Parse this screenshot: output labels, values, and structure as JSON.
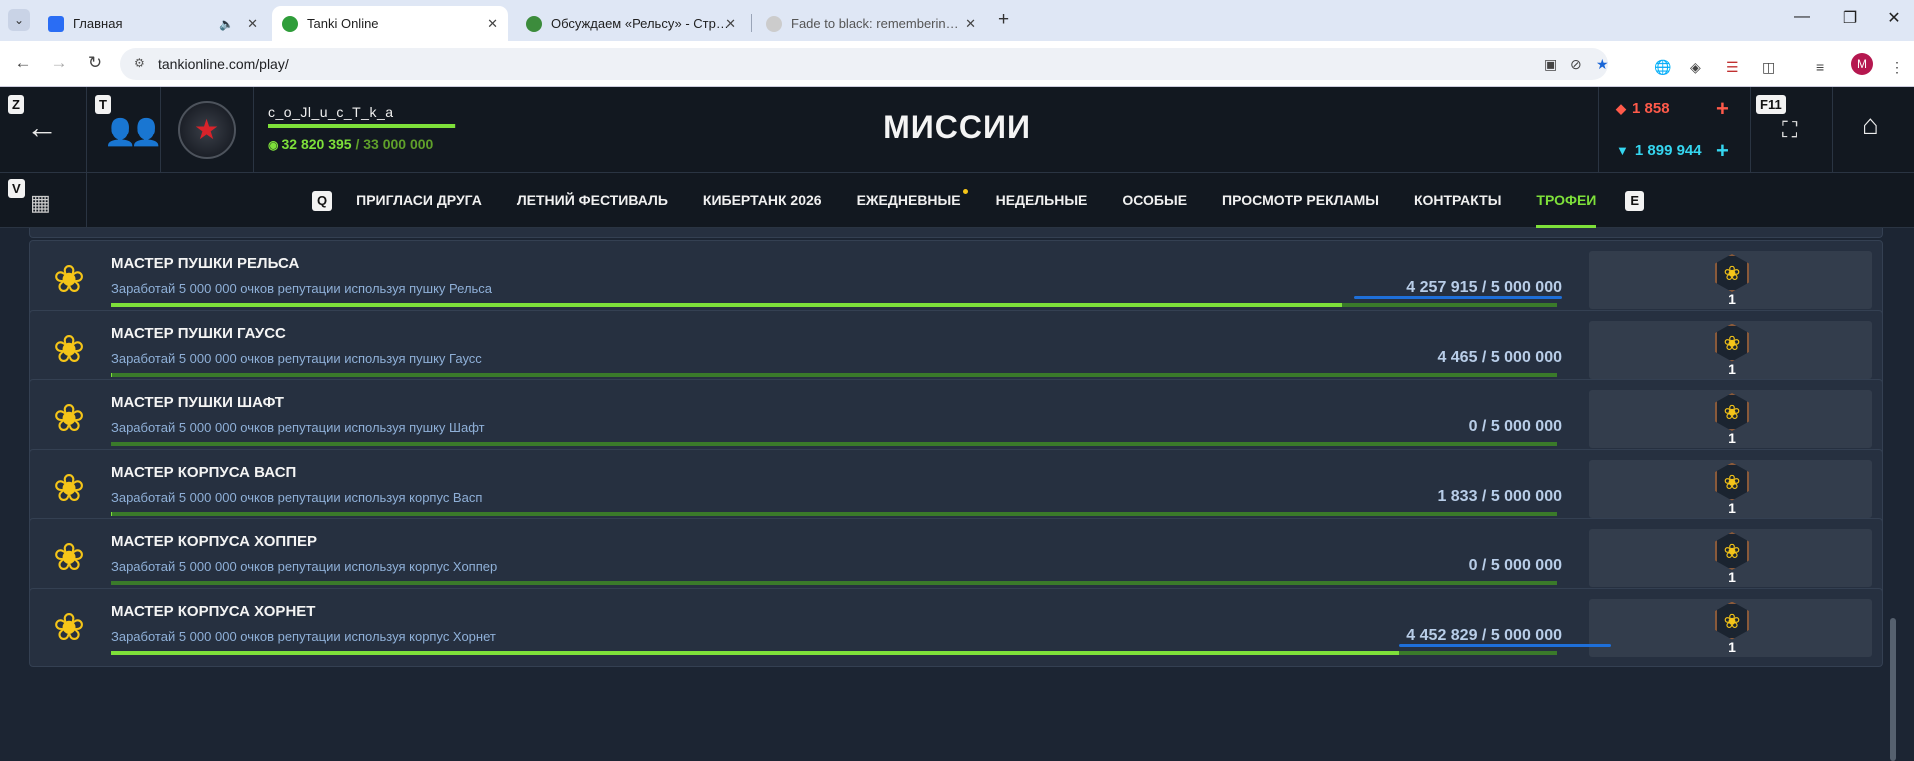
{
  "browser": {
    "tabs": [
      {
        "title": "Главная",
        "favicon_color": "#2a6df4"
      },
      {
        "title": "Tanki Online",
        "favicon_color": "#2f9d3a"
      },
      {
        "title": "Обсуждаем «Рельсу» - Страни",
        "favicon_color": "#3c8c3c"
      },
      {
        "title": "Fade to black: remembering co",
        "favicon_color": "#cccccc"
      }
    ],
    "url": "tankionline.com/play/",
    "profile_initial": "M"
  },
  "game": {
    "keys": {
      "z": "Z",
      "t": "T",
      "v": "V",
      "q": "Q",
      "e": "E",
      "f11": "F11"
    },
    "player": {
      "name": "c_o_Jl_u_c_T_k_a",
      "xp_current": "32 820 395",
      "xp_max": "33 000 000",
      "xp_progress": 0.9945
    },
    "title": "МИССИИ",
    "currency": {
      "crystals_red": "1 858",
      "crystals_blue": "1 899 944"
    },
    "nav_tabs": [
      {
        "label": "ПРИГЛАСИ ДРУГА",
        "active": false,
        "dot": false
      },
      {
        "label": "ЛЕТНИЙ ФЕСТИВАЛЬ",
        "active": false,
        "dot": false
      },
      {
        "label": "КИБЕРТАНК 2026",
        "active": false,
        "dot": false
      },
      {
        "label": "ЕЖЕДНЕВНЫЕ",
        "active": false,
        "dot": true
      },
      {
        "label": "НЕДЕЛЬНЫЕ",
        "active": false,
        "dot": false
      },
      {
        "label": "ОСОБЫЕ",
        "active": false,
        "dot": false
      },
      {
        "label": "ПРОСМОТР РЕКЛАМЫ",
        "active": false,
        "dot": false
      },
      {
        "label": "КОНТРАКТЫ",
        "active": false,
        "dot": false
      },
      {
        "label": "ТРОФЕИ",
        "active": true,
        "dot": false
      }
    ],
    "missions": [
      {
        "name": "МАСТЕР ПУШКИ РЕЛЬСА",
        "desc": "Заработай 5 000 000 очков репутации используя пушку Рельса",
        "progress": "4 257 915 / 5 000 000",
        "ratio": 0.8516,
        "reward_count": "1",
        "annotated": true
      },
      {
        "name": "МАСТЕР ПУШКИ ГАУСС",
        "desc": "Заработай 5 000 000 очков репутации используя пушку Гаусс",
        "progress": "4 465 / 5 000 000",
        "ratio": 0.0009,
        "reward_count": "1",
        "annotated": false
      },
      {
        "name": "МАСТЕР ПУШКИ ШАФТ",
        "desc": "Заработай 5 000 000 очков репутации используя пушку Шафт",
        "progress": "0 / 5 000 000",
        "ratio": 0,
        "reward_count": "1",
        "annotated": false
      },
      {
        "name": "МАСТЕР КОРПУСА ВАСП",
        "desc": "Заработай 5 000 000 очков репутации используя корпус Васп",
        "progress": "1 833 / 5 000 000",
        "ratio": 0.0004,
        "reward_count": "1",
        "annotated": false
      },
      {
        "name": "МАСТЕР КОРПУСА ХОППЕР",
        "desc": "Заработай 5 000 000 очков репутации используя корпус Хоппер",
        "progress": "0 / 5 000 000",
        "ratio": 0,
        "reward_count": "1",
        "annotated": false
      },
      {
        "name": "МАСТЕР КОРПУСА ХОРНЕТ",
        "desc": "Заработай 5 000 000 очков репутации используя корпус Хорнет",
        "progress": "4 452 829 / 5 000 000",
        "ratio": 0.8906,
        "reward_count": "1",
        "annotated": true
      }
    ]
  }
}
